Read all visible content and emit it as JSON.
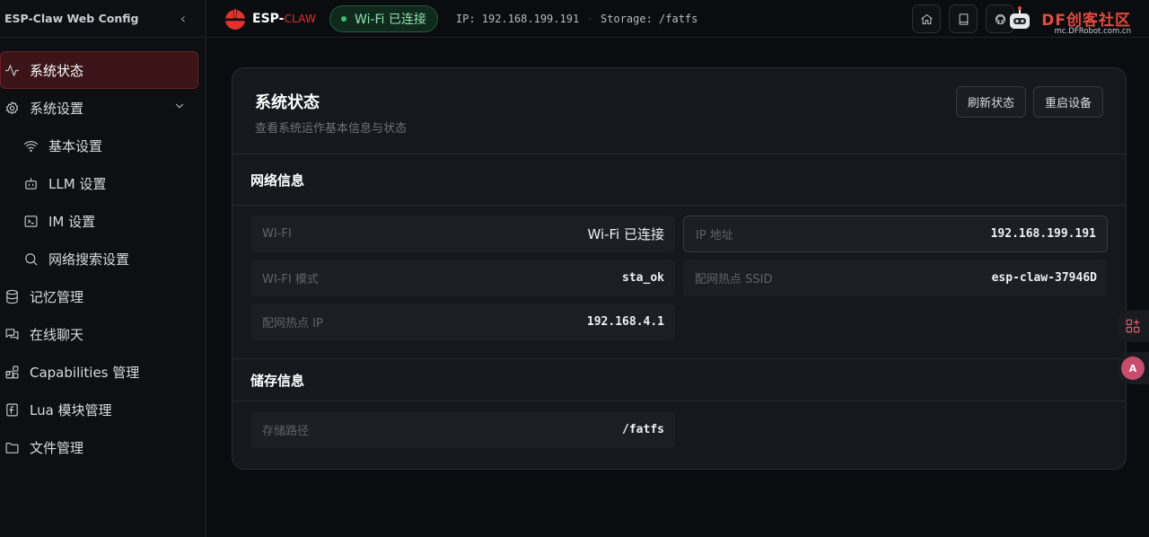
{
  "sidebar": {
    "title": "ESP-Claw Web Config",
    "items": [
      {
        "label": "系统状态",
        "icon": "activity-icon",
        "active": true
      },
      {
        "label": "系统设置",
        "icon": "gear-icon",
        "expanded": true
      },
      {
        "label": "基本设置",
        "icon": "wifi-icon",
        "sub": true
      },
      {
        "label": "LLM 设置",
        "icon": "robot-icon",
        "sub": true
      },
      {
        "label": "IM 设置",
        "icon": "chat-box-icon",
        "sub": true
      },
      {
        "label": "网络搜索设置",
        "icon": "search-icon",
        "sub": true
      },
      {
        "label": "记忆管理",
        "icon": "database-icon"
      },
      {
        "label": "在线聊天",
        "icon": "messages-icon"
      },
      {
        "label": "Capabilities 管理",
        "icon": "blocks-icon"
      },
      {
        "label": "Lua 模块管理",
        "icon": "file-code-icon"
      },
      {
        "label": "文件管理",
        "icon": "folder-icon"
      }
    ]
  },
  "topbar": {
    "brand_main": "ESP-",
    "brand_accent": "CLAW",
    "wifi_status": "Wi-Fi 已连接",
    "ip_text": "IP: 192.168.199.191",
    "separator": "·",
    "storage_text": "Storage: /fatfs",
    "watermark_main": "DF创客社区",
    "watermark_sub": "mc.DFRobot.com.cn"
  },
  "card": {
    "title": "系统状态",
    "subtitle": "查看系统运作基本信息与状态",
    "refresh_label": "刷新状态",
    "restart_label": "重启设备",
    "network": {
      "title": "网络信息",
      "fields": [
        {
          "key": "WI-FI",
          "value": "Wi-Fi 已连接"
        },
        {
          "key": "IP 地址",
          "value": "192.168.199.191"
        },
        {
          "key": "WI-FI 模式",
          "value": "sta_ok"
        },
        {
          "key": "配网热点 SSID",
          "value": "esp-claw-37946D"
        },
        {
          "key": "配网热点 IP",
          "value": "192.168.4.1"
        }
      ]
    },
    "storage": {
      "title": "储存信息",
      "fields": [
        {
          "key": "存储路径",
          "value": "/fatfs"
        }
      ]
    }
  },
  "floating": {
    "translate_label": "A"
  },
  "colors": {
    "accent_red": "#e1322d",
    "active_bg": "#3a1417",
    "wifi_green": "#36c46f"
  }
}
